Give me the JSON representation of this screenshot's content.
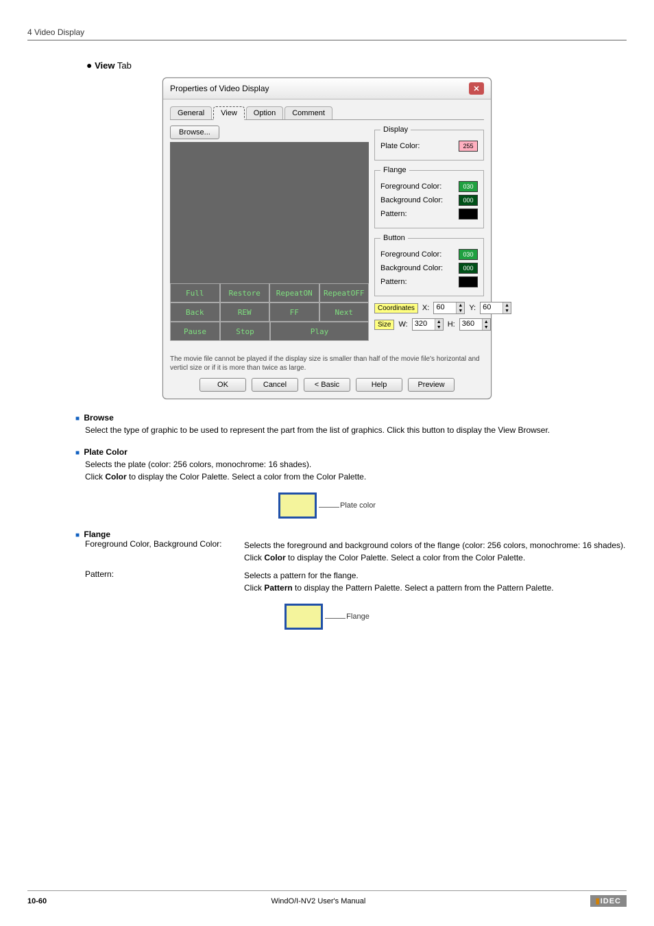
{
  "header": {
    "chapter": "4 Video Display"
  },
  "tab_heading": {
    "bullet": "●",
    "label": "View",
    "suffix": " Tab"
  },
  "dialog": {
    "title": "Properties of Video Display",
    "close_glyph": "✕",
    "tabs": [
      "General",
      "View",
      "Option",
      "Comment"
    ],
    "browse": "Browse...",
    "grid": {
      "r1": [
        "Full",
        "Restore",
        "RepeatON",
        "RepeatOFF"
      ],
      "r2": [
        "Back",
        "REW",
        "FF",
        "Next"
      ],
      "r3": [
        "Pause",
        "Stop",
        "Play"
      ]
    },
    "groups": {
      "display": {
        "legend": "Display",
        "plate_label": "Plate Color:",
        "plate_value": "255"
      },
      "flange": {
        "legend": "Flange",
        "fg_label": "Foreground Color:",
        "fg_value": "030",
        "bg_label": "Background Color:",
        "bg_value": "000",
        "pattern_label": "Pattern:"
      },
      "button": {
        "legend": "Button",
        "fg_label": "Foreground Color:",
        "fg_value": "030",
        "bg_label": "Background Color:",
        "bg_value": "000",
        "pattern_label": "Pattern:"
      }
    },
    "coords": {
      "label1": "Coordinates",
      "x_label": "X:",
      "x_value": "60",
      "y_label": "Y:",
      "y_value": "60",
      "label2": "Size",
      "w_label": "W:",
      "w_value": "320",
      "h_label": "H:",
      "h_value": "360"
    },
    "warn": "The movie file cannot be played if the display size is smaller than half of the movie file's horizontal and verticl size or if it is more than twice as large.",
    "buttons": {
      "ok": "OK",
      "cancel": "Cancel",
      "basic": "< Basic",
      "help": "Help",
      "preview": "Preview"
    }
  },
  "sections": {
    "browse": {
      "title": "Browse",
      "body": "Select the type of graphic to be used to represent the part from the list of graphics. Click this button to display the View Browser."
    },
    "plate": {
      "title": "Plate Color",
      "line1": "Selects the plate (color: 256 colors, monochrome: 16 shades).",
      "line2_pre": "Click ",
      "line2_bold": "Color",
      "line2_post": " to display the Color Palette. Select a color from the Color Palette.",
      "demo_label": "Plate color"
    },
    "flange": {
      "title": "Flange",
      "fg_label": "Foreground Color, Background Color:",
      "fg_text": "Selects the foreground and background colors of the flange (color: 256 colors, monochrome: 16 shades).",
      "fg_text2_pre": "Click ",
      "fg_text2_bold": "Color",
      "fg_text2_post": " to display the Color Palette. Select a color from the Color Palette.",
      "pat_label": "Pattern:",
      "pat_text": "Selects a pattern for the flange.",
      "pat_text2_pre": "Click ",
      "pat_text2_bold": "Pattern",
      "pat_text2_post": " to display the Pattern Palette. Select a pattern from the Pattern Palette.",
      "demo_label": "Flange"
    }
  },
  "footer": {
    "page": "10-60",
    "center": "WindO/I-NV2 User's Manual",
    "logo": "IDEC"
  }
}
